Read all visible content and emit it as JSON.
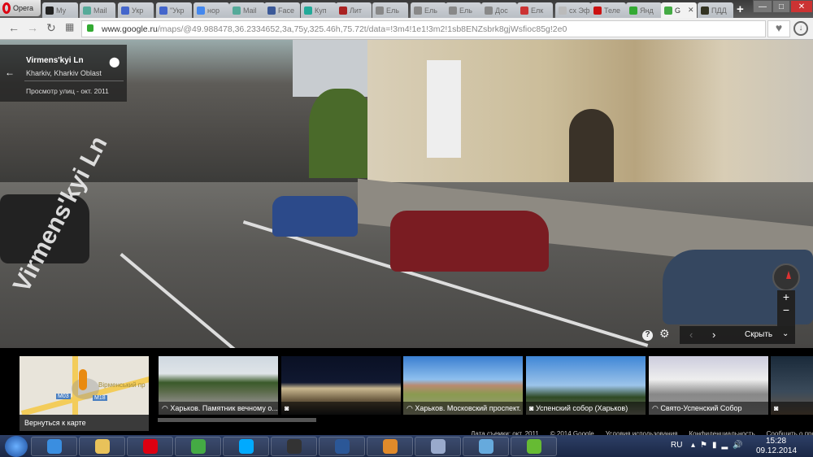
{
  "browser": {
    "opera_label": "Opera",
    "tabs": [
      {
        "label": "Му",
        "c": "#222"
      },
      {
        "label": "Mail",
        "c": "#5a9"
      },
      {
        "label": "Укр",
        "c": "#46c"
      },
      {
        "label": "\"Укр",
        "c": "#46c"
      },
      {
        "label": "нор",
        "c": "#48e"
      },
      {
        "label": "Mail",
        "c": "#5a9"
      },
      {
        "label": "Face",
        "c": "#3b5998"
      },
      {
        "label": "Куп",
        "c": "#2a9"
      },
      {
        "label": "Лит",
        "c": "#a22"
      },
      {
        "label": "Ель",
        "c": "#888"
      },
      {
        "label": "Ель",
        "c": "#888"
      },
      {
        "label": "Ель",
        "c": "#888"
      },
      {
        "label": "Дос",
        "c": "#888"
      },
      {
        "label": "Елк",
        "c": "#c33"
      },
      {
        "label": "сх Эф",
        "c": "#bbb"
      },
      {
        "label": "Теле",
        "c": "#c11"
      },
      {
        "label": "Янд",
        "c": "#3a3"
      },
      {
        "label": "G",
        "c": "#4a4",
        "active": true
      },
      {
        "label": "ПДД",
        "c": "#332"
      }
    ],
    "new_tab": "+",
    "window_controls": [
      "—",
      "□",
      "✕"
    ],
    "url_domain": "www.google.ru",
    "url_rest": "/maps/@49.988478,36.2334652,3a,75y,325.46h,75.72t/data=!3m4!1e1!3m2!1sb8ENZsbrk8gjWsfioc85g!2e0"
  },
  "streetview": {
    "street_name": "Virmens'kyi Ln",
    "location": "Kharkiv, Kharkiv Oblast",
    "capture": "Просмотр улиц - окт. 2011",
    "road_label": "Virmens'kyi Ln",
    "hide_label": "Скрыть",
    "zoom_in": "+",
    "zoom_out": "−"
  },
  "strip": {
    "back_to_map": "Вернуться к карте",
    "map_label": "Вірменський пр",
    "map_shields": [
      "M03",
      "M18"
    ],
    "thumbs": [
      {
        "caption": "Харьков. Памятник вечному о...",
        "type": "pano",
        "bg": "linear-gradient(#cfd8e0 0%,#dfe4e8 30%,#3a5a2a 45%,#5b6b4a 60%,#8a8a85 80%,#777 100%)"
      },
      {
        "caption": "",
        "type": "photo",
        "bg": "linear-gradient(#0a1024 0%,#101830 45%,#c9b890 55%,#6a5a40 75%,#1a1a1a 100%)"
      },
      {
        "caption": "Харьков. Московский проспект.",
        "type": "pano",
        "bg": "linear-gradient(#3a7ed0 0%,#8fc0ee 40%,#b98a70 50%,#8a9a50 65%,#9a9a80 100%)"
      },
      {
        "caption": "Успенский собор (Харьков)",
        "type": "photo",
        "bg": "linear-gradient(#3f86d6 0%,#9cc4ea 50%,#2f4a25 70%,#7a7a6a 100%)"
      },
      {
        "caption": "Свято-Успенский Собор",
        "type": "pano",
        "bg": "linear-gradient(#ccd 0%,#eee 40%,#888 65%,#999 100%)"
      },
      {
        "caption": "",
        "type": "photo",
        "bg": "linear-gradient(#1a2a3a,#3a4a5a 60%,#654 100%)"
      }
    ],
    "footer": [
      "Дата съемки: окт. 2011",
      "© 2014 Google",
      "Условия использования",
      "Конфиденциальность",
      "Сообщить о проблеме"
    ]
  },
  "taskbar": {
    "apps": [
      {
        "name": "ie",
        "c": "#3a8ee0"
      },
      {
        "name": "explorer",
        "c": "#e8c25a"
      },
      {
        "name": "opera",
        "c": "#d01"
      },
      {
        "name": "chrome",
        "c": "#4a4"
      },
      {
        "name": "skype",
        "c": "#0af"
      },
      {
        "name": "camera",
        "c": "#333"
      },
      {
        "name": "word",
        "c": "#2b5797"
      },
      {
        "name": "home",
        "c": "#e08a2a"
      },
      {
        "name": "paint",
        "c": "#9ac"
      },
      {
        "name": "photos",
        "c": "#6ad"
      },
      {
        "name": "utorrent",
        "c": "#6b3"
      }
    ],
    "lang": "RU",
    "time": "15:28",
    "date": "09.12.2014"
  }
}
